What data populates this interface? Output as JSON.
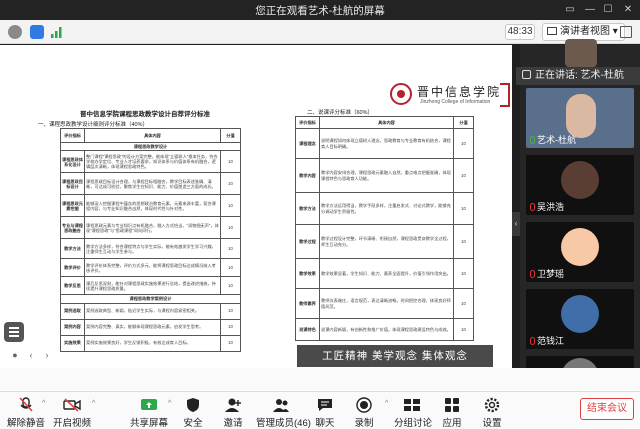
{
  "window": {
    "title": "您正在观看艺术-杜航的屏幕"
  },
  "infobar": {
    "timer": "48:33",
    "view_label": "演讲者视图"
  },
  "slide_left": {
    "title": "晋中信息学院课程思政教学设计自荐评分标准",
    "section1": "一、课程思政教学设计细则评分标准（40%）",
    "headers": [
      "评价指标",
      "具体内容",
      "分值"
    ],
    "group1": "课程思政教学设计",
    "rows": [
      {
        "cat": "课程思政体系化设计",
        "text": "整门课程\"课程思政\"的设计方案完整，能体现\"立德树人\"根本任务，符合学校办学定位、专业人才培养要求，知识体系与价值体系有机融合，逻辑层次清晰，体现课程思政特色。",
        "score": "10"
      },
      {
        "cat": "课程思政目标设计",
        "text": "课程思政目标设计合理，与课程目标相融合，教学目标表述准确、清晰，可达成可检验，聚焦学生在知识、能力、价值塑造三方面的成长。",
        "score": "10"
      },
      {
        "cat": "课程思政元素挖掘",
        "text": "能够深入挖掘课程中蕴含的思想政治教育元素，元素来源丰富，契合课程内容，与专业知识融合自然，体现时代性与针对性。",
        "score": "10"
      },
      {
        "cat": "专业与课程思政融合",
        "text": "课程思政元素与专业知识点有机融合，融入方式恰当，\"润物细无声\"，体现\"课程思政\"与\"思政课程\"同向同行。",
        "score": "10"
      },
      {
        "cat": "教学方法",
        "text": "教学方法多样，符合课程特点与学生实际，能有效激发学生学习兴趣，注重师生互动与学生参与。",
        "score": "10"
      },
      {
        "cat": "教学评价",
        "text": "教学评价体系完整，评价方式多元，能将课程思政目标达成情况纳入考核评价。",
        "score": "10"
      },
      {
        "cat": "教学反思",
        "text": "课后反思深刻，能针对课程思政实施效果进行总结，提出改进措施，持续提升课程思政质量。",
        "score": "10"
      }
    ],
    "group2": "课程思政教学案例设计",
    "rows2": [
      {
        "cat": "案例选取",
        "text": "案例选取典型、新颖，贴近学生实际，与课程内容紧密相关。",
        "score": "10"
      },
      {
        "cat": "案例内容",
        "text": "案例内容完整、真实，能够体现课程思政元素，启发学生思考。",
        "score": "10"
      },
      {
        "cat": "实施效果",
        "text": "案例实施效果良好，学生反馈积极，有效达成育人目标。",
        "score": "10"
      }
    ]
  },
  "slide_right": {
    "section2": "二、说课评分标准（60%）",
    "headers": [
      "评价指标",
      "具体内容",
      "分值"
    ],
    "rows": [
      {
        "cat": "课程理念",
        "text": "说明课程如何体现立德树人理念，思政教育与专业教育有机结合，课程育人目标明确。",
        "score": "10"
      },
      {
        "cat": "教学内容",
        "text": "教学内容安排合理，课程思政元素融入自然，重点难点把握准确，体现课程特色与思政育人功能。",
        "score": "10"
      },
      {
        "cat": "教学方法",
        "text": "教学方法运用得当，教学手段多样，注重启发式、讨论式教学，能够充分调动学生积极性。",
        "score": "10"
      },
      {
        "cat": "教学过程",
        "text": "教学过程设计完整，环节清晰、衔接自然，课程思政贯穿教学全过程，师生互动充分。",
        "score": "10"
      },
      {
        "cat": "教学效果",
        "text": "教学效果显著，学生知识、能力、素养全面提升，价值引领作用突出。",
        "score": "10"
      },
      {
        "cat": "教师素养",
        "text": "教师仪表端庄，语言规范，表达清晰流畅，时间把控合理，体现良好师德风范。",
        "score": "10"
      },
      {
        "cat": "说课特色",
        "text": "说课内容新颖，有创新性和推广价值，体现课程思政建设特色与成效。",
        "score": "10"
      }
    ]
  },
  "logo": {
    "cn": "晋中信息学院",
    "en": "Jinzhong College of Information"
  },
  "caption": "工匠精神   美学观念   集体观念",
  "speaking": "正在讲话: 艺术-杜航",
  "participants": [
    {
      "name": "艺术-杜航"
    },
    {
      "name": "吴洪浩"
    },
    {
      "name": "卫梦瑶"
    },
    {
      "name": "范钱江"
    },
    {
      "name": ""
    }
  ],
  "toolbar": {
    "mute": "解除静音",
    "video": "开启视频",
    "share": "共享屏幕",
    "security": "安全",
    "invite": "邀请",
    "members": "管理成员(46)",
    "chat": "聊天",
    "record": "录制",
    "breakout": "分组讨论",
    "apps": "应用",
    "settings": "设置",
    "end": "结束会议"
  },
  "colors": {
    "accent_red": "#e04040",
    "logo_red": "#b4232a",
    "share_green": "#2aa84a"
  }
}
